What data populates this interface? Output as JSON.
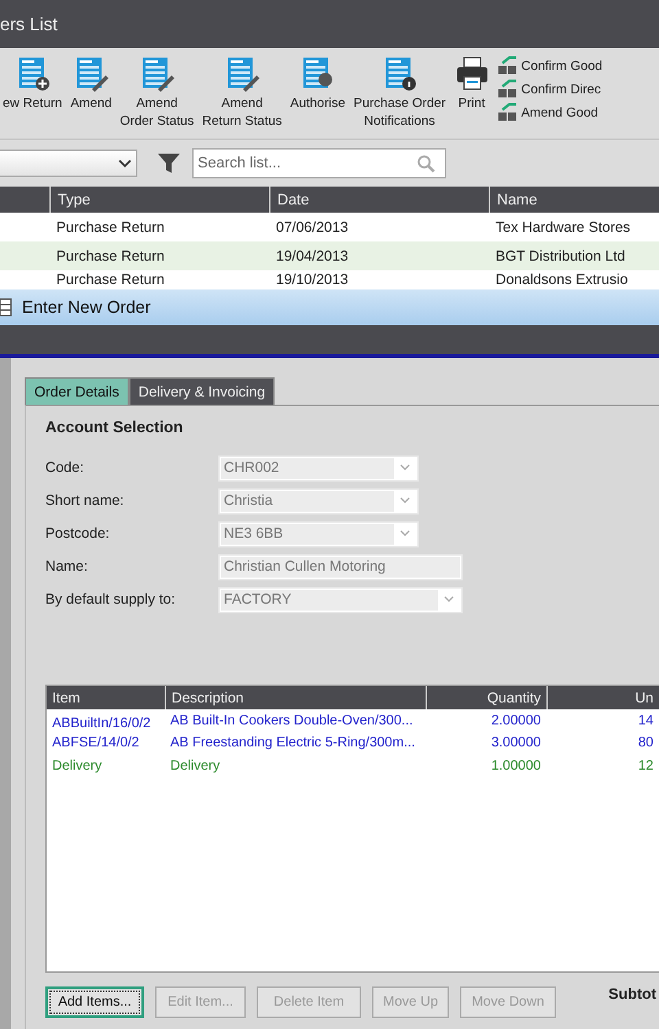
{
  "back_window": {
    "title": "ers List",
    "toolbar": [
      {
        "label": "ew Return"
      },
      {
        "label": "Amend"
      },
      {
        "label": "Amend\nOrder Status"
      },
      {
        "label": "Amend\nReturn Status"
      },
      {
        "label": "Authorise"
      },
      {
        "label": "Purchase Order\nNotifications"
      },
      {
        "label": "Print"
      }
    ],
    "side_actions": [
      "Confirm Good",
      "Confirm Direc",
      "Amend Good"
    ],
    "search": {
      "placeholder": "Search list..."
    },
    "columns": [
      "Type",
      "Date",
      "Name"
    ],
    "rows": [
      {
        "cells": [
          "Purchase Return",
          "07/06/2013",
          "Tex Hardware Stores"
        ],
        "selected": false
      },
      {
        "cells": [
          "Purchase Return",
          "19/04/2013",
          "BGT Distribution Ltd"
        ],
        "selected": true
      },
      {
        "cells": [
          "Purchase Return",
          "19/10/2013",
          "Donaldsons Extrusio"
        ],
        "selected": false
      }
    ]
  },
  "dialog": {
    "title": "Enter New Order",
    "tabs": [
      {
        "label": "Order Details",
        "selected": true
      },
      {
        "label": "Delivery & Invoicing",
        "selected": false
      }
    ],
    "section": "Account Selection",
    "fields": [
      {
        "label": "Code:",
        "value": "CHR002",
        "kind": "dropdown"
      },
      {
        "label": "Short name:",
        "value": "Christia",
        "kind": "dropdown"
      },
      {
        "label": "Postcode:",
        "value": "NE3 6BB",
        "kind": "dropdown"
      },
      {
        "label": "Name:",
        "value": "Christian Cullen Motoring",
        "kind": "text"
      },
      {
        "label": "By default supply to:",
        "value": "FACTORY",
        "kind": "dropdown-wide"
      }
    ],
    "items": {
      "columns": [
        "Item",
        "Description",
        "Quantity",
        "Un"
      ],
      "rows": [
        {
          "kind": "item",
          "cells": [
            "ABBuiltIn/16/0/2",
            "AB Built-In Cookers Double-Oven/300...",
            "2.00000",
            "14"
          ]
        },
        {
          "kind": "item",
          "cells": [
            "ABFSE/14/0/2",
            "AB Freestanding Electric 5-Ring/300m...",
            "3.00000",
            "80"
          ]
        },
        {
          "kind": "delivery",
          "cells": [
            "Delivery",
            "Delivery",
            "1.00000",
            "12"
          ]
        }
      ]
    },
    "buttons": [
      {
        "label": "Add Items...",
        "disabled": false
      },
      {
        "label": "Edit Item...",
        "disabled": true
      },
      {
        "label": "Delete Item",
        "disabled": true
      },
      {
        "label": "Move Up",
        "disabled": true
      },
      {
        "label": "Move Down",
        "disabled": true
      }
    ],
    "subtotal_label": "Subtot"
  }
}
